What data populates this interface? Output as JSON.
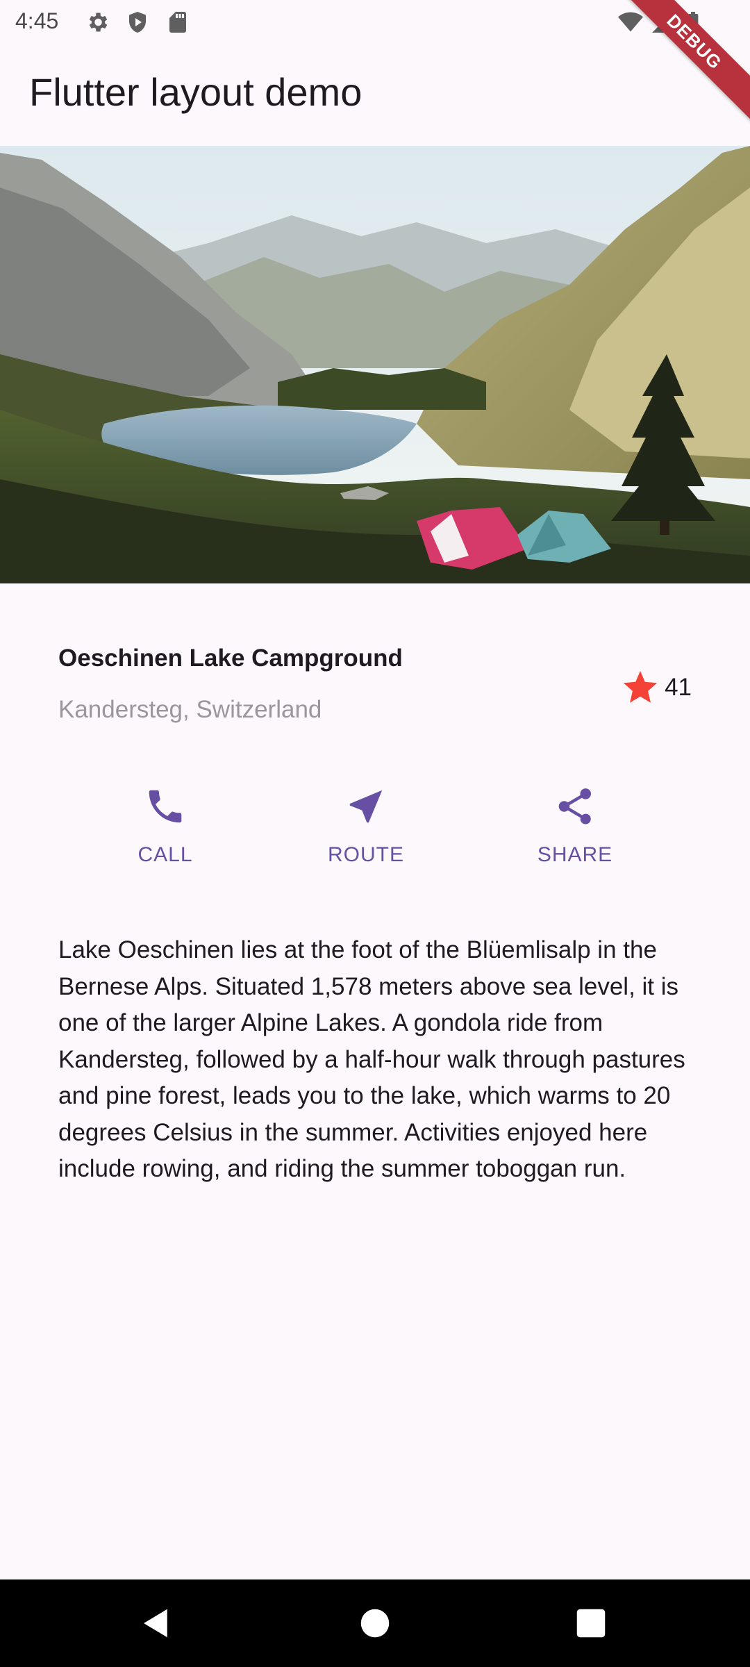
{
  "status_bar": {
    "time": "4:45",
    "icons": [
      "settings-icon",
      "shield-play-icon",
      "sd-card-icon",
      "wifi-icon",
      "signal-icon",
      "battery-icon"
    ]
  },
  "debug_banner": "DEBUG",
  "app_bar": {
    "title": "Flutter layout demo"
  },
  "hero_image": {
    "subject": "lake-campground-photo"
  },
  "place": {
    "name": "Oeschinen Lake Campground",
    "location": "Kandersteg, Switzerland",
    "rating_count": "41",
    "star_color": "#f44336"
  },
  "actions": [
    {
      "label": "CALL",
      "icon": "phone-icon"
    },
    {
      "label": "ROUTE",
      "icon": "navigation-arrow-icon"
    },
    {
      "label": "SHARE",
      "icon": "share-icon"
    }
  ],
  "accent_color": "#6750a4",
  "description": "Lake Oeschinen lies at the foot of the Blüemlisalp in the Bernese Alps. Situated 1,578 meters above sea level, it is one of the larger Alpine Lakes. A gondola ride from Kandersteg, followed by a half-hour walk through pastures and pine forest, leads you to the lake, which warms to 20 degrees Celsius in the summer. Activities enjoyed here include rowing, and riding the summer toboggan run.",
  "nav_bar": {
    "buttons": [
      "back-icon",
      "home-icon",
      "recents-icon"
    ]
  }
}
